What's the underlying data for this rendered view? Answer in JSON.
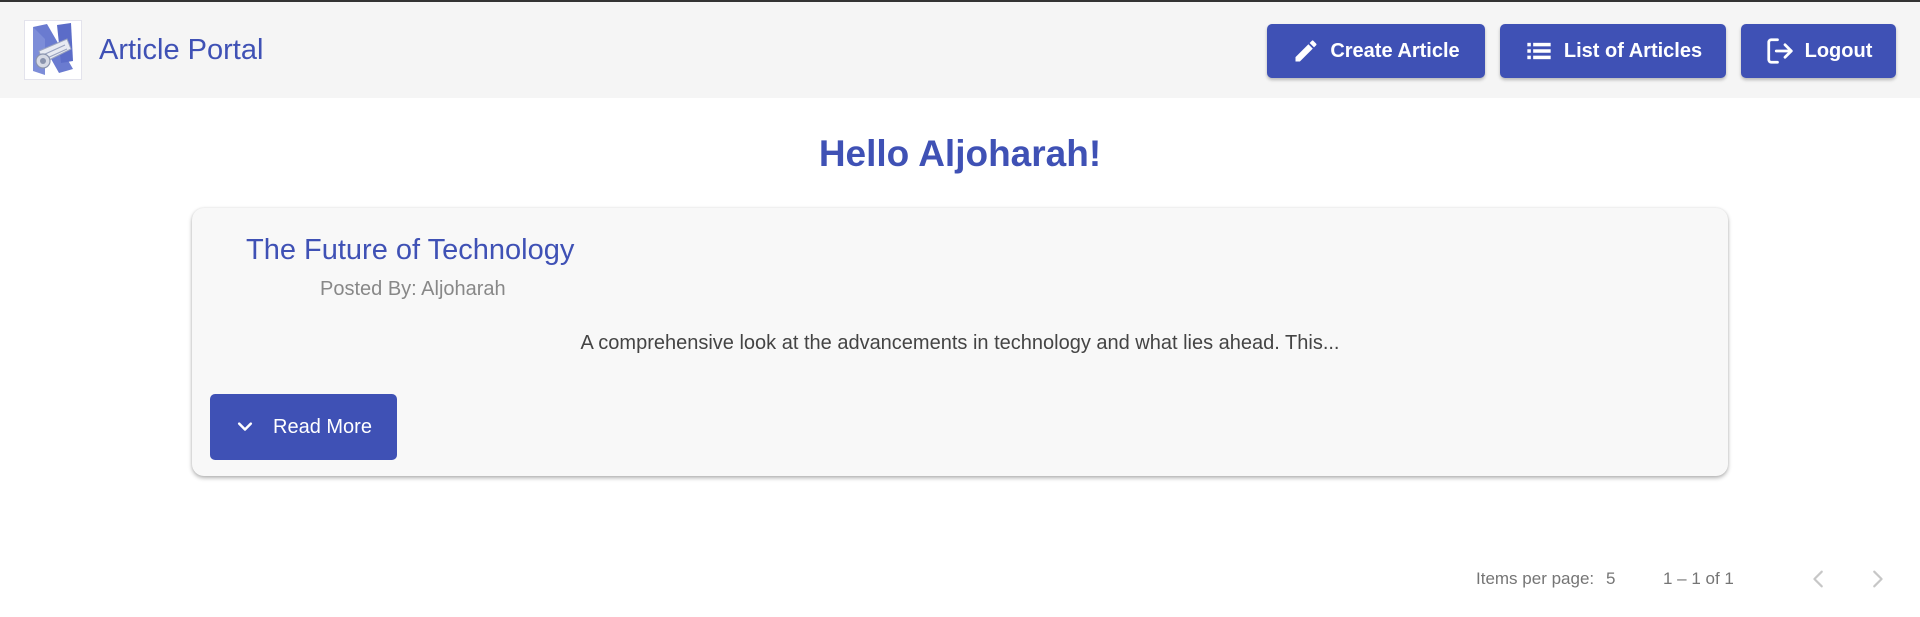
{
  "header": {
    "app_title": "Article Portal",
    "logo_icon": "newspaper-logo-icon",
    "buttons": {
      "create_article": {
        "label": "Create Article",
        "icon": "pencil-icon"
      },
      "list_of_articles": {
        "label": "List of Articles",
        "icon": "list-icon"
      },
      "logout": {
        "label": "Logout",
        "icon": "logout-icon"
      }
    }
  },
  "main": {
    "greeting": "Hello Aljoharah!",
    "articles": [
      {
        "title": "The Future of Technology",
        "author_line": "Posted By: Aljoharah",
        "excerpt": "A comprehensive look at the advancements in technology and what lies ahead. This...",
        "read_more_label": "Read More",
        "read_more_icon": "chevron-down-icon"
      }
    ]
  },
  "paginator": {
    "items_per_page_label": "Items per page:",
    "items_per_page_value": "5",
    "range_label": "1 – 1 of 1",
    "prev_icon": "chevron-left-icon",
    "next_icon": "chevron-right-icon"
  },
  "colors": {
    "primary": "#3f51b5",
    "navbar_background": "#f5f5f5",
    "card_background": "#f8f8f8",
    "muted_text": "#888888",
    "body_text": "#444444"
  }
}
